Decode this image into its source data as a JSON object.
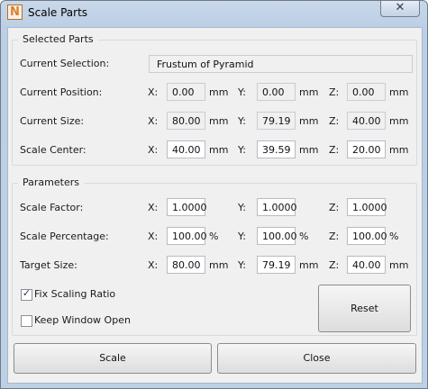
{
  "window": {
    "title": "Scale Parts",
    "app_icon_letter": "N",
    "close_symbol": "✕"
  },
  "selected": {
    "group_title": "Selected Parts",
    "current_selection_label": "Current Selection:",
    "current_selection_value": "Frustum of Pyramid",
    "rows": [
      {
        "label": "Current Position:",
        "x": "0.00",
        "y": "0.00",
        "z": "0.00",
        "unit": "mm"
      },
      {
        "label": "Current Size:",
        "x": "80.00",
        "y": "79.19",
        "z": "40.00",
        "unit": "mm"
      },
      {
        "label": "Scale Center:",
        "x": "40.00",
        "y": "39.59",
        "z": "20.00",
        "unit": "mm"
      }
    ]
  },
  "parameters": {
    "group_title": "Parameters",
    "rows": [
      {
        "label": "Scale Factor:",
        "x": "1.0000",
        "y": "1.0000",
        "z": "1.0000",
        "unit": ""
      },
      {
        "label": "Scale Percentage:",
        "x": "100.00",
        "y": "100.00",
        "z": "100.00",
        "unit": "%"
      },
      {
        "label": "Target Size:",
        "x": "80.00",
        "y": "79.19",
        "z": "40.00",
        "unit": "mm"
      }
    ],
    "fix_scaling_ratio": {
      "label": "Fix Scaling Ratio",
      "checked": true,
      "mark": "✓"
    },
    "keep_window_open": {
      "label": "Keep Window Open",
      "checked": false
    },
    "reset_label": "Reset"
  },
  "axes": {
    "x": "X:",
    "y": "Y:",
    "z": "Z:"
  },
  "footer": {
    "scale_label": "Scale",
    "close_label": "Close"
  }
}
